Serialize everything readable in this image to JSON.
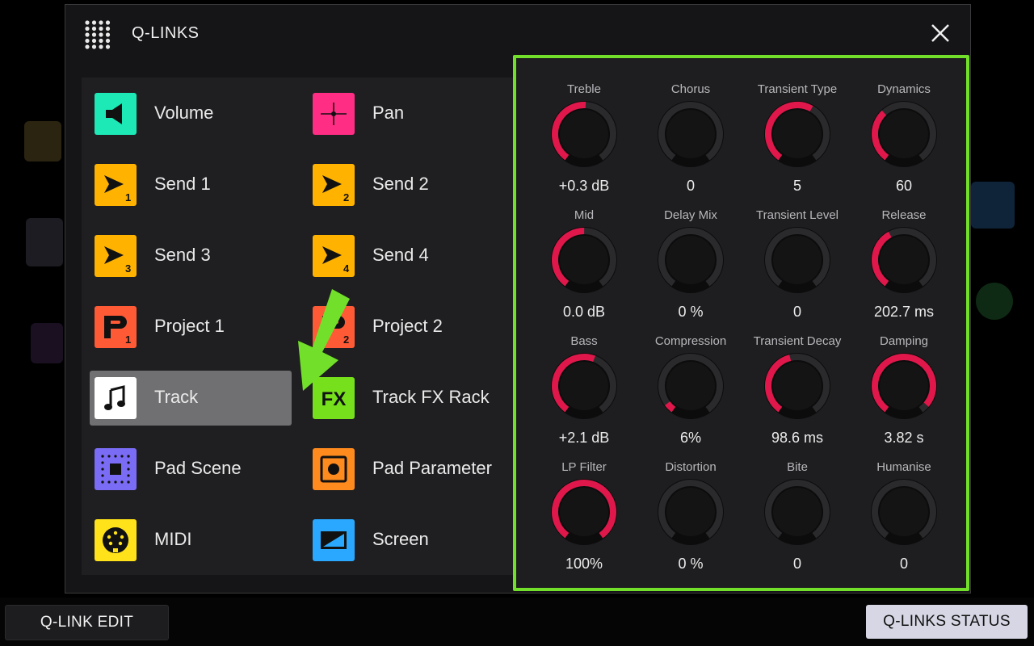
{
  "modal": {
    "title": "Q-LINKS",
    "icons": {
      "menu": "dot-grid-icon",
      "close": "close-icon"
    }
  },
  "targets": [
    {
      "key": "volume",
      "label": "Volume",
      "icon": "speaker-icon",
      "color": "#1de9b6",
      "col": 0,
      "row": 0
    },
    {
      "key": "pan",
      "label": "Pan",
      "icon": "pan-crosshair-icon",
      "color": "#ff2d84",
      "col": 1,
      "row": 0
    },
    {
      "key": "send1",
      "label": "Send 1",
      "icon": "send-arrow-icon",
      "badge": "1",
      "color": "#ffb300",
      "col": 0,
      "row": 1
    },
    {
      "key": "send2",
      "label": "Send 2",
      "icon": "send-arrow-icon",
      "badge": "2",
      "color": "#ffb300",
      "col": 1,
      "row": 1
    },
    {
      "key": "send3",
      "label": "Send 3",
      "icon": "send-arrow-icon",
      "badge": "3",
      "color": "#ffb300",
      "col": 0,
      "row": 2
    },
    {
      "key": "send4",
      "label": "Send 4",
      "icon": "send-arrow-icon",
      "badge": "4",
      "color": "#ffb300",
      "col": 1,
      "row": 2
    },
    {
      "key": "project1",
      "label": "Project 1",
      "icon": "project-p-icon",
      "badge": "1",
      "color": "#ff5a36",
      "col": 0,
      "row": 3
    },
    {
      "key": "project2",
      "label": "Project 2",
      "icon": "project-p-icon",
      "badge": "2",
      "color": "#ff5a36",
      "col": 1,
      "row": 3
    },
    {
      "key": "track",
      "label": "Track",
      "icon": "music-note-icon",
      "color": "#ffffff",
      "col": 0,
      "row": 4,
      "selected": true
    },
    {
      "key": "trackfx",
      "label": "Track FX Rack",
      "icon": "fx-icon",
      "color": "#76e01c",
      "col": 1,
      "row": 4
    },
    {
      "key": "padscene",
      "label": "Pad Scene",
      "icon": "pad-grid-icon",
      "color": "#7b6cf6",
      "col": 0,
      "row": 5
    },
    {
      "key": "padparam",
      "label": "Pad Parameter",
      "icon": "pad-dot-icon",
      "color": "#ff8a1e",
      "col": 1,
      "row": 5
    },
    {
      "key": "midi",
      "label": "MIDI",
      "icon": "midi-din-icon",
      "color": "#ffe21a",
      "col": 0,
      "row": 6
    },
    {
      "key": "screen",
      "label": "Screen",
      "icon": "screen-icon",
      "color": "#2aa8ff",
      "col": 1,
      "row": 6
    }
  ],
  "knobs": [
    {
      "name": "Treble",
      "value": "+0.3 dB",
      "level": 0.51
    },
    {
      "name": "Chorus",
      "value": "0",
      "level": 0
    },
    {
      "name": "Transient Type",
      "value": "5",
      "level": 0.6
    },
    {
      "name": "Dynamics",
      "value": "60",
      "level": 0.35
    },
    {
      "name": "Mid",
      "value": "0.0 dB",
      "level": 0.5
    },
    {
      "name": "Delay Mix",
      "value": "0 %",
      "level": 0
    },
    {
      "name": "Transient Level",
      "value": "0",
      "level": 0
    },
    {
      "name": "Release",
      "value": "202.7 ms",
      "level": 0.4
    },
    {
      "name": "Bass",
      "value": "+2.1 dB",
      "level": 0.57
    },
    {
      "name": "Compression",
      "value": "6%",
      "level": 0.06
    },
    {
      "name": "Transient Decay",
      "value": "98.6 ms",
      "level": 0.45
    },
    {
      "name": "Damping",
      "value": "3.82 s",
      "level": 0.95
    },
    {
      "name": "LP Filter",
      "value": "100%",
      "level": 1.0
    },
    {
      "name": "Distortion",
      "value": "0 %",
      "level": 0
    },
    {
      "name": "Bite",
      "value": "0",
      "level": 0
    },
    {
      "name": "Humanise",
      "value": "0",
      "level": 0
    }
  ],
  "bottom": {
    "left_button": "Q-LINK EDIT",
    "right_button": "Q-LINKS STATUS"
  },
  "colors": {
    "knob_accent": "#e0174a",
    "highlight_border": "#72e02a",
    "arrow": "#72e02a",
    "selected_bg": "#707072"
  }
}
